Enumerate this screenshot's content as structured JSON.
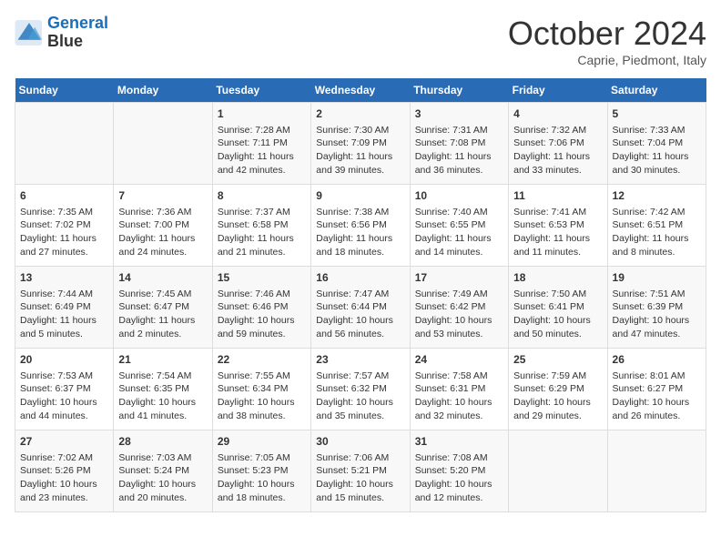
{
  "logo": {
    "line1": "General",
    "line2": "Blue"
  },
  "title": "October 2024",
  "subtitle": "Caprie, Piedmont, Italy",
  "days_of_week": [
    "Sunday",
    "Monday",
    "Tuesday",
    "Wednesday",
    "Thursday",
    "Friday",
    "Saturday"
  ],
  "weeks": [
    [
      {
        "day": "",
        "sunrise": "",
        "sunset": "",
        "daylight": ""
      },
      {
        "day": "",
        "sunrise": "",
        "sunset": "",
        "daylight": ""
      },
      {
        "day": "1",
        "sunrise": "Sunrise: 7:28 AM",
        "sunset": "Sunset: 7:11 PM",
        "daylight": "Daylight: 11 hours and 42 minutes."
      },
      {
        "day": "2",
        "sunrise": "Sunrise: 7:30 AM",
        "sunset": "Sunset: 7:09 PM",
        "daylight": "Daylight: 11 hours and 39 minutes."
      },
      {
        "day": "3",
        "sunrise": "Sunrise: 7:31 AM",
        "sunset": "Sunset: 7:08 PM",
        "daylight": "Daylight: 11 hours and 36 minutes."
      },
      {
        "day": "4",
        "sunrise": "Sunrise: 7:32 AM",
        "sunset": "Sunset: 7:06 PM",
        "daylight": "Daylight: 11 hours and 33 minutes."
      },
      {
        "day": "5",
        "sunrise": "Sunrise: 7:33 AM",
        "sunset": "Sunset: 7:04 PM",
        "daylight": "Daylight: 11 hours and 30 minutes."
      }
    ],
    [
      {
        "day": "6",
        "sunrise": "Sunrise: 7:35 AM",
        "sunset": "Sunset: 7:02 PM",
        "daylight": "Daylight: 11 hours and 27 minutes."
      },
      {
        "day": "7",
        "sunrise": "Sunrise: 7:36 AM",
        "sunset": "Sunset: 7:00 PM",
        "daylight": "Daylight: 11 hours and 24 minutes."
      },
      {
        "day": "8",
        "sunrise": "Sunrise: 7:37 AM",
        "sunset": "Sunset: 6:58 PM",
        "daylight": "Daylight: 11 hours and 21 minutes."
      },
      {
        "day": "9",
        "sunrise": "Sunrise: 7:38 AM",
        "sunset": "Sunset: 6:56 PM",
        "daylight": "Daylight: 11 hours and 18 minutes."
      },
      {
        "day": "10",
        "sunrise": "Sunrise: 7:40 AM",
        "sunset": "Sunset: 6:55 PM",
        "daylight": "Daylight: 11 hours and 14 minutes."
      },
      {
        "day": "11",
        "sunrise": "Sunrise: 7:41 AM",
        "sunset": "Sunset: 6:53 PM",
        "daylight": "Daylight: 11 hours and 11 minutes."
      },
      {
        "day": "12",
        "sunrise": "Sunrise: 7:42 AM",
        "sunset": "Sunset: 6:51 PM",
        "daylight": "Daylight: 11 hours and 8 minutes."
      }
    ],
    [
      {
        "day": "13",
        "sunrise": "Sunrise: 7:44 AM",
        "sunset": "Sunset: 6:49 PM",
        "daylight": "Daylight: 11 hours and 5 minutes."
      },
      {
        "day": "14",
        "sunrise": "Sunrise: 7:45 AM",
        "sunset": "Sunset: 6:47 PM",
        "daylight": "Daylight: 11 hours and 2 minutes."
      },
      {
        "day": "15",
        "sunrise": "Sunrise: 7:46 AM",
        "sunset": "Sunset: 6:46 PM",
        "daylight": "Daylight: 10 hours and 59 minutes."
      },
      {
        "day": "16",
        "sunrise": "Sunrise: 7:47 AM",
        "sunset": "Sunset: 6:44 PM",
        "daylight": "Daylight: 10 hours and 56 minutes."
      },
      {
        "day": "17",
        "sunrise": "Sunrise: 7:49 AM",
        "sunset": "Sunset: 6:42 PM",
        "daylight": "Daylight: 10 hours and 53 minutes."
      },
      {
        "day": "18",
        "sunrise": "Sunrise: 7:50 AM",
        "sunset": "Sunset: 6:41 PM",
        "daylight": "Daylight: 10 hours and 50 minutes."
      },
      {
        "day": "19",
        "sunrise": "Sunrise: 7:51 AM",
        "sunset": "Sunset: 6:39 PM",
        "daylight": "Daylight: 10 hours and 47 minutes."
      }
    ],
    [
      {
        "day": "20",
        "sunrise": "Sunrise: 7:53 AM",
        "sunset": "Sunset: 6:37 PM",
        "daylight": "Daylight: 10 hours and 44 minutes."
      },
      {
        "day": "21",
        "sunrise": "Sunrise: 7:54 AM",
        "sunset": "Sunset: 6:35 PM",
        "daylight": "Daylight: 10 hours and 41 minutes."
      },
      {
        "day": "22",
        "sunrise": "Sunrise: 7:55 AM",
        "sunset": "Sunset: 6:34 PM",
        "daylight": "Daylight: 10 hours and 38 minutes."
      },
      {
        "day": "23",
        "sunrise": "Sunrise: 7:57 AM",
        "sunset": "Sunset: 6:32 PM",
        "daylight": "Daylight: 10 hours and 35 minutes."
      },
      {
        "day": "24",
        "sunrise": "Sunrise: 7:58 AM",
        "sunset": "Sunset: 6:31 PM",
        "daylight": "Daylight: 10 hours and 32 minutes."
      },
      {
        "day": "25",
        "sunrise": "Sunrise: 7:59 AM",
        "sunset": "Sunset: 6:29 PM",
        "daylight": "Daylight: 10 hours and 29 minutes."
      },
      {
        "day": "26",
        "sunrise": "Sunrise: 8:01 AM",
        "sunset": "Sunset: 6:27 PM",
        "daylight": "Daylight: 10 hours and 26 minutes."
      }
    ],
    [
      {
        "day": "27",
        "sunrise": "Sunrise: 7:02 AM",
        "sunset": "Sunset: 5:26 PM",
        "daylight": "Daylight: 10 hours and 23 minutes."
      },
      {
        "day": "28",
        "sunrise": "Sunrise: 7:03 AM",
        "sunset": "Sunset: 5:24 PM",
        "daylight": "Daylight: 10 hours and 20 minutes."
      },
      {
        "day": "29",
        "sunrise": "Sunrise: 7:05 AM",
        "sunset": "Sunset: 5:23 PM",
        "daylight": "Daylight: 10 hours and 18 minutes."
      },
      {
        "day": "30",
        "sunrise": "Sunrise: 7:06 AM",
        "sunset": "Sunset: 5:21 PM",
        "daylight": "Daylight: 10 hours and 15 minutes."
      },
      {
        "day": "31",
        "sunrise": "Sunrise: 7:08 AM",
        "sunset": "Sunset: 5:20 PM",
        "daylight": "Daylight: 10 hours and 12 minutes."
      },
      {
        "day": "",
        "sunrise": "",
        "sunset": "",
        "daylight": ""
      },
      {
        "day": "",
        "sunrise": "",
        "sunset": "",
        "daylight": ""
      }
    ]
  ]
}
